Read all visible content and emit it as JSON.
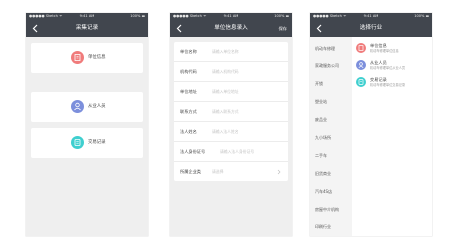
{
  "statusbar": {
    "carrier": "●●●●● Sketch ᯤ",
    "time": "9:41 AM",
    "battery": "100% ▬"
  },
  "screen1": {
    "title": "采集记录",
    "cards": [
      {
        "label": "单位信息",
        "icon": "building-icon",
        "color": "#f07b7b"
      },
      {
        "label": "从业人员",
        "icon": "person-icon",
        "color": "#7c8fdc"
      },
      {
        "label": "交易记录",
        "icon": "record-icon",
        "color": "#3fcfcf"
      }
    ]
  },
  "screen2": {
    "title": "单位信息录入",
    "right_action": "保存",
    "fields": [
      {
        "label": "单位名称",
        "placeholder": "请输入单位名称"
      },
      {
        "label": "机构代码",
        "placeholder": "请输入机构代码"
      },
      {
        "label": "单位地址",
        "placeholder": "请输入单位地址"
      },
      {
        "label": "联系方式",
        "placeholder": "请输入联系方式"
      },
      {
        "label": "法人姓名",
        "placeholder": "请输入法人姓名"
      },
      {
        "label": "法人身份证号",
        "placeholder": "请输入法人身份证号"
      },
      {
        "label": "所属企业类",
        "placeholder": "请选择"
      }
    ]
  },
  "screen3": {
    "title": "选择行业",
    "industries": [
      "机动车修理",
      "家政服务公司",
      "开锁",
      "塑业站",
      "废品业",
      "九小场所",
      "二手车",
      "旧货商业",
      "汽车4S店",
      "房屋中介机构",
      "印刷行业"
    ],
    "options": [
      {
        "title": "单位信息",
        "desc": "机动车修理单位信息",
        "icon": "building-icon",
        "color": "#f07b7b"
      },
      {
        "title": "从业人员",
        "desc": "机动车修理单位从业人员",
        "icon": "person-icon",
        "color": "#7c8fdc"
      },
      {
        "title": "交易记录",
        "desc": "机动车修理单位交易记录",
        "icon": "record-icon",
        "color": "#3fcfcf"
      }
    ]
  }
}
